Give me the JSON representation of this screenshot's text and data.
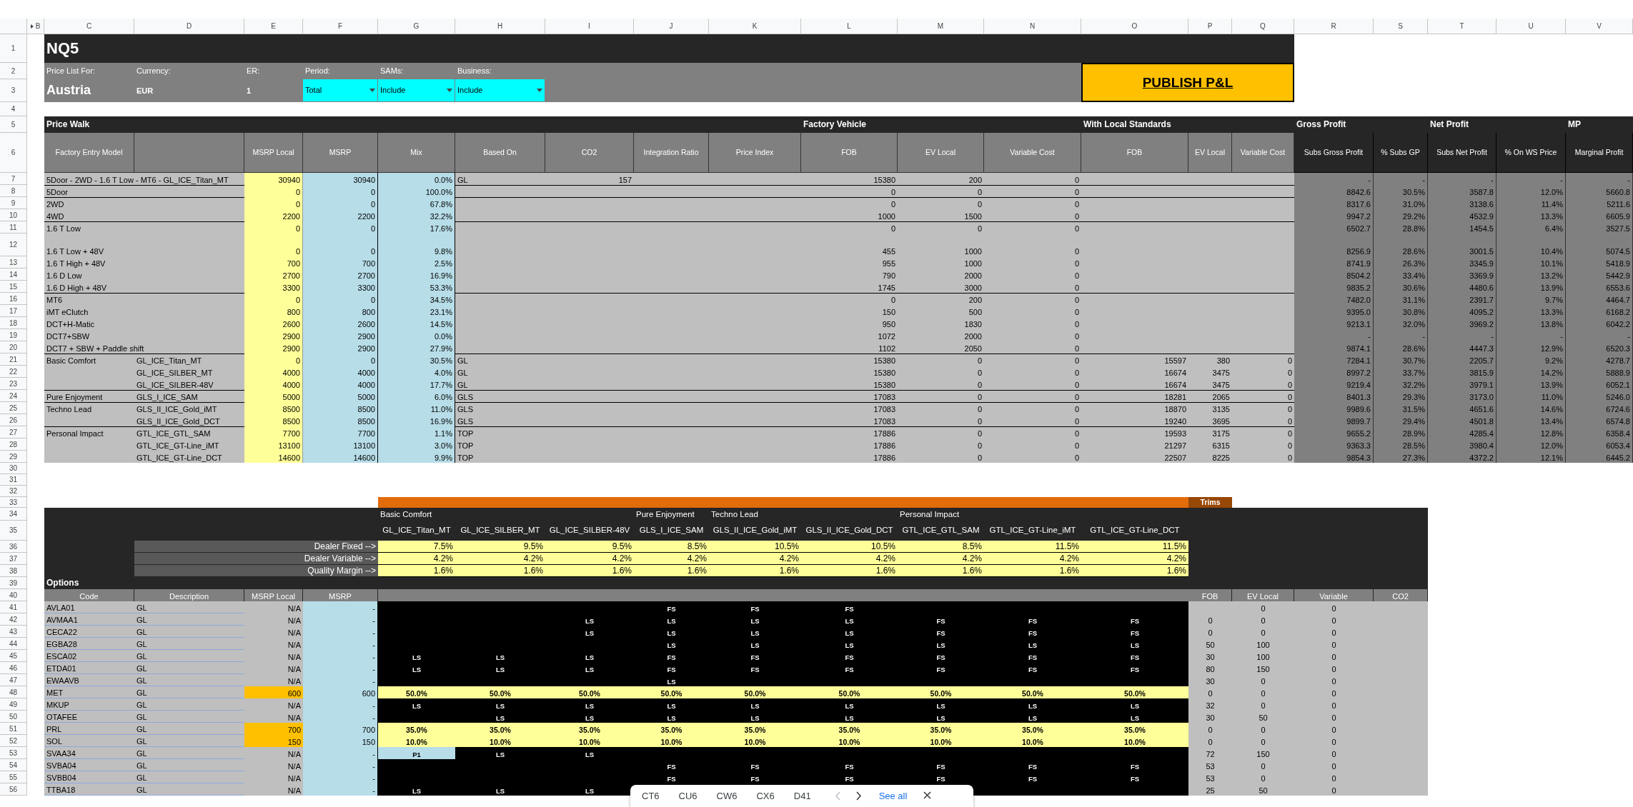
{
  "column_headers": [
    "B",
    "C",
    "D",
    "E",
    "F",
    "G",
    "H",
    "I",
    "J",
    "K",
    "L",
    "M",
    "N",
    "O",
    "P",
    "Q",
    "R",
    "S",
    "T",
    "U",
    "V"
  ],
  "row_numbers": [
    "1",
    "2",
    "3",
    "4",
    "5",
    "6",
    "7",
    "8",
    "9",
    "10",
    "11",
    "12",
    "13",
    "14",
    "15",
    "16",
    "17",
    "18",
    "19",
    "20",
    "21",
    "22",
    "23",
    "24",
    "25",
    "26",
    "27",
    "28",
    "29",
    "30",
    "31",
    "32",
    "33",
    "34",
    "35",
    "36",
    "37",
    "38",
    "39",
    "40",
    "41",
    "42",
    "43",
    "44",
    "45",
    "46",
    "47",
    "48",
    "49",
    "50",
    "51",
    "52",
    "53",
    "54",
    "55",
    "56"
  ],
  "header": {
    "title": "NQ5",
    "fields": [
      {
        "label": "Price List For:",
        "value": "Austria",
        "kind": "country"
      },
      {
        "label": "Currency:",
        "value": "EUR",
        "kind": "text"
      },
      {
        "label": "ER:",
        "value": "1",
        "kind": "number"
      },
      {
        "label": "Period:",
        "value": "Total",
        "kind": "dropdown"
      },
      {
        "label": "SAMs:",
        "value": "Include",
        "kind": "dropdown"
      },
      {
        "label": "Business:",
        "value": "Include",
        "kind": "dropdown"
      }
    ],
    "publish_button": "PUBLISH P&L"
  },
  "price_walk": {
    "title": "Price Walk",
    "bands": [
      "Factory Vehicle",
      "With Local Standards",
      "Gross Profit",
      "Net Profit",
      "MP"
    ],
    "columns": [
      "Factory Entry Model",
      "MSRP Local",
      "MSRP",
      "Mix",
      "Based On",
      "CO2",
      "Integration Ratio",
      "Price Index",
      "FOB",
      "EV Local",
      "Variable Cost",
      "FOB",
      "EV Local",
      "Variable Cost",
      "Subs Gross Profit",
      "% Subs GP",
      "Subs Net Profit",
      "% On WS Price",
      "Marginal Profit"
    ],
    "groups": [
      {
        "rows": [
          {
            "label": "5Door - 2WD - 1.6 T Low - MT6 - GL_ICE_Titan_MT",
            "msrp_local": "30940",
            "msrp": "30940",
            "mix": "0.0%",
            "based_on": "GL",
            "co2": "157",
            "fob": "15380",
            "ev_local": "200",
            "variable_cost": "0",
            "gross_profit": "-",
            "gp_pct": "-",
            "net_profit": "-",
            "ws_pct": "-",
            "marginal_profit": "-"
          }
        ]
      },
      {
        "rows": [
          {
            "label": "5Door",
            "msrp_local": "0",
            "msrp": "0",
            "mix": "100.0%",
            "fob": "0",
            "ev_local": "0",
            "variable_cost": "0",
            "gross_profit": "8842.6",
            "gp_pct": "30.5%",
            "net_profit": "3587.8",
            "ws_pct": "12.0%",
            "marginal_profit": "5660.8"
          }
        ]
      },
      {
        "rows": [
          {
            "label": "2WD",
            "msrp_local": "0",
            "msrp": "0",
            "mix": "67.8%",
            "fob": "0",
            "ev_local": "0",
            "variable_cost": "0",
            "gross_profit": "8317.6",
            "gp_pct": "31.0%",
            "net_profit": "3138.6",
            "ws_pct": "11.4%",
            "marginal_profit": "5211.6"
          },
          {
            "label": "4WD",
            "msrp_local": "2200",
            "msrp": "2200",
            "mix": "32.2%",
            "fob": "1000",
            "ev_local": "1500",
            "variable_cost": "0",
            "gross_profit": "9947.2",
            "gp_pct": "29.2%",
            "net_profit": "4532.9",
            "ws_pct": "13.3%",
            "marginal_profit": "6605.9"
          }
        ]
      },
      {
        "rows": [
          {
            "label": "1.6 T Low",
            "msrp_local": "0",
            "msrp": "0",
            "mix": "17.6%",
            "fob": "0",
            "ev_local": "0",
            "variable_cost": "0",
            "gross_profit": "6502.7",
            "gp_pct": "28.8%",
            "net_profit": "1454.5",
            "ws_pct": "6.4%",
            "marginal_profit": "3527.5"
          },
          {
            "label": "1.6 T Low + 48V",
            "msrp_local": "0",
            "msrp": "0",
            "mix": "9.8%",
            "fob": "455",
            "ev_local": "1000",
            "variable_cost": "0",
            "gross_profit": "8256.9",
            "gp_pct": "28.6%",
            "net_profit": "3001.5",
            "ws_pct": "10.4%",
            "marginal_profit": "5074.5"
          },
          {
            "label": "1.6 T High + 48V",
            "msrp_local": "700",
            "msrp": "700",
            "mix": "2.5%",
            "fob": "955",
            "ev_local": "1000",
            "variable_cost": "0",
            "gross_profit": "8741.9",
            "gp_pct": "26.3%",
            "net_profit": "3345.9",
            "ws_pct": "10.1%",
            "marginal_profit": "5418.9"
          },
          {
            "label": "1.6 D Low",
            "msrp_local": "2700",
            "msrp": "2700",
            "mix": "16.9%",
            "fob": "790",
            "ev_local": "2000",
            "variable_cost": "0",
            "gross_profit": "8504.2",
            "gp_pct": "33.4%",
            "net_profit": "3369.9",
            "ws_pct": "13.2%",
            "marginal_profit": "5442.9"
          },
          {
            "label": "1.6 D High + 48V",
            "msrp_local": "3300",
            "msrp": "3300",
            "mix": "53.3%",
            "fob": "1745",
            "ev_local": "3000",
            "variable_cost": "0",
            "gross_profit": "9835.2",
            "gp_pct": "30.6%",
            "net_profit": "4480.6",
            "ws_pct": "13.9%",
            "marginal_profit": "6553.6"
          }
        ]
      },
      {
        "rows": [
          {
            "label": "MT6",
            "msrp_local": "0",
            "msrp": "0",
            "mix": "34.5%",
            "fob": "0",
            "ev_local": "200",
            "variable_cost": "0",
            "gross_profit": "7482.0",
            "gp_pct": "31.1%",
            "net_profit": "2391.7",
            "ws_pct": "9.7%",
            "marginal_profit": "4464.7"
          },
          {
            "label": "iMT eClutch",
            "msrp_local": "800",
            "msrp": "800",
            "mix": "23.1%",
            "fob": "150",
            "ev_local": "500",
            "variable_cost": "0",
            "gross_profit": "9395.0",
            "gp_pct": "30.8%",
            "net_profit": "4095.2",
            "ws_pct": "13.3%",
            "marginal_profit": "6168.2"
          },
          {
            "label": "DCT+H-Matic",
            "msrp_local": "2600",
            "msrp": "2600",
            "mix": "14.5%",
            "fob": "950",
            "ev_local": "1830",
            "variable_cost": "0",
            "gross_profit": "9213.1",
            "gp_pct": "32.0%",
            "net_profit": "3969.2",
            "ws_pct": "13.8%",
            "marginal_profit": "6042.2"
          },
          {
            "label": "DCT7+SBW",
            "msrp_local": "2900",
            "msrp": "2900",
            "mix": "0.0%",
            "fob": "1072",
            "ev_local": "2000",
            "variable_cost": "0",
            "gross_profit": "-",
            "gp_pct": "-",
            "net_profit": "-",
            "ws_pct": "-",
            "marginal_profit": "-"
          },
          {
            "label": "DCT7 + SBW + Paddle shift",
            "msrp_local": "2900",
            "msrp": "2900",
            "mix": "27.9%",
            "fob": "1102",
            "ev_local": "2050",
            "variable_cost": "0",
            "gross_profit": "9874.1",
            "gp_pct": "28.6%",
            "net_profit": "4447.3",
            "ws_pct": "12.9%",
            "marginal_profit": "6520.3"
          }
        ]
      },
      {
        "rows": [
          {
            "label": "Basic Comfort",
            "model": "GL_ICE_Titan_MT",
            "msrp_local": "0",
            "msrp": "0",
            "mix": "30.5%",
            "based_on": "GL",
            "fob": "15380",
            "ev_local": "0",
            "variable_cost": "0",
            "ls_fob": "15597",
            "ls_ev_local": "380",
            "ls_variable_cost": "0",
            "gross_profit": "7284.1",
            "gp_pct": "30.7%",
            "net_profit": "2205.7",
            "ws_pct": "9.2%",
            "marginal_profit": "4278.7"
          },
          {
            "model": "GL_ICE_SILBER_MT",
            "msrp_local": "4000",
            "msrp": "4000",
            "mix": "4.0%",
            "based_on": "GL",
            "fob": "15380",
            "ev_local": "0",
            "variable_cost": "0",
            "ls_fob": "16674",
            "ls_ev_local": "3475",
            "ls_variable_cost": "0",
            "gross_profit": "8997.2",
            "gp_pct": "33.7%",
            "net_profit": "3815.9",
            "ws_pct": "14.2%",
            "marginal_profit": "5888.9"
          },
          {
            "model": "GL_ICE_SILBER-48V",
            "msrp_local": "4000",
            "msrp": "4000",
            "mix": "17.7%",
            "based_on": "GL",
            "fob": "15380",
            "ev_local": "0",
            "variable_cost": "0",
            "ls_fob": "16674",
            "ls_ev_local": "3475",
            "ls_variable_cost": "0",
            "gross_profit": "9219.4",
            "gp_pct": "32.2%",
            "net_profit": "3979.1",
            "ws_pct": "13.9%",
            "marginal_profit": "6052.1"
          }
        ]
      },
      {
        "rows": [
          {
            "label": "Pure Enjoyment",
            "model": "GLS_I_ICE_SAM",
            "msrp_local": "5000",
            "msrp": "5000",
            "mix": "6.0%",
            "based_on": "GLS",
            "fob": "17083",
            "ev_local": "0",
            "variable_cost": "0",
            "ls_fob": "18281",
            "ls_ev_local": "2065",
            "ls_variable_cost": "0",
            "gross_profit": "8401.3",
            "gp_pct": "29.3%",
            "net_profit": "3173.0",
            "ws_pct": "11.0%",
            "marginal_profit": "5246.0"
          }
        ]
      },
      {
        "rows": [
          {
            "label": "Techno Lead",
            "model": "GLS_II_ICE_Gold_iMT",
            "msrp_local": "8500",
            "msrp": "8500",
            "mix": "11.0%",
            "based_on": "GLS",
            "fob": "17083",
            "ev_local": "0",
            "variable_cost": "0",
            "ls_fob": "18870",
            "ls_ev_local": "3135",
            "ls_variable_cost": "0",
            "gross_profit": "9989.6",
            "gp_pct": "31.5%",
            "net_profit": "4651.6",
            "ws_pct": "14.6%",
            "marginal_profit": "6724.6"
          },
          {
            "model": "GLS_II_ICE_Gold_DCT",
            "msrp_local": "8500",
            "msrp": "8500",
            "mix": "16.9%",
            "based_on": "GLS",
            "fob": "17083",
            "ev_local": "0",
            "variable_cost": "0",
            "ls_fob": "19240",
            "ls_ev_local": "3695",
            "ls_variable_cost": "0",
            "gross_profit": "9899.7",
            "gp_pct": "29.4%",
            "net_profit": "4501.8",
            "ws_pct": "13.4%",
            "marginal_profit": "6574.8"
          }
        ]
      },
      {
        "rows": [
          {
            "label": "Personal Impact",
            "model": "GTL_ICE_GTL_SAM",
            "msrp_local": "7700",
            "msrp": "7700",
            "mix": "1.1%",
            "based_on": "TOP",
            "fob": "17886",
            "ev_local": "0",
            "variable_cost": "0",
            "ls_fob": "19593",
            "ls_ev_local": "3175",
            "ls_variable_cost": "0",
            "gross_profit": "9655.2",
            "gp_pct": "28.9%",
            "net_profit": "4285.4",
            "ws_pct": "12.8%",
            "marginal_profit": "6358.4"
          },
          {
            "model": "GTL_ICE_GT-Line_iMT",
            "msrp_local": "13100",
            "msrp": "13100",
            "mix": "3.0%",
            "based_on": "TOP",
            "fob": "17886",
            "ev_local": "0",
            "variable_cost": "0",
            "ls_fob": "21297",
            "ls_ev_local": "6315",
            "ls_variable_cost": "0",
            "gross_profit": "9363.3",
            "gp_pct": "28.5%",
            "net_profit": "3980.4",
            "ws_pct": "12.0%",
            "marginal_profit": "6053.4"
          },
          {
            "model": "GTL_ICE_GT-Line_DCT",
            "msrp_local": "14600",
            "msrp": "14600",
            "mix": "9.9%",
            "based_on": "TOP",
            "fob": "17886",
            "ev_local": "0",
            "variable_cost": "0",
            "ls_fob": "22507",
            "ls_ev_local": "8225",
            "ls_variable_cost": "0",
            "gross_profit": "9854.3",
            "gp_pct": "27.3%",
            "net_profit": "4372.2",
            "ws_pct": "12.1%",
            "marginal_profit": "6445.2"
          }
        ]
      }
    ]
  },
  "trims": {
    "header": "Trims",
    "groups": [
      {
        "name": "Basic Comfort",
        "models": [
          "GL_ICE_Titan_MT",
          "GL_ICE_SILBER_MT",
          "GL_ICE_SILBER-48V"
        ]
      },
      {
        "name": "Pure Enjoyment",
        "models": [
          "GLS_I_ICE_SAM"
        ]
      },
      {
        "name": "Techno Lead",
        "models": [
          "GLS_II_ICE_Gold_iMT",
          "GLS_II_ICE_Gold_DCT"
        ]
      },
      {
        "name": "Personal Impact",
        "models": [
          "GTL_ICE_GTL_SAM",
          "GTL_ICE_GT-Line_iMT",
          "GTL_ICE_GT-Line_DCT"
        ]
      }
    ],
    "margins": [
      {
        "label": "Dealer Fixed -->",
        "values": [
          "7.5%",
          "9.5%",
          "9.5%",
          "8.5%",
          "10.5%",
          "10.5%",
          "8.5%",
          "11.5%",
          "11.5%"
        ]
      },
      {
        "label": "Dealer Variable -->",
        "values": [
          "4.2%",
          "4.2%",
          "4.2%",
          "4.2%",
          "4.2%",
          "4.2%",
          "4.2%",
          "4.2%",
          "4.2%"
        ]
      },
      {
        "label": "Quality Margin -->",
        "values": [
          "1.6%",
          "1.6%",
          "1.6%",
          "1.6%",
          "1.6%",
          "1.6%",
          "1.6%",
          "1.6%",
          "1.6%"
        ]
      }
    ]
  },
  "options": {
    "title": "Options",
    "columns": [
      "Code",
      "Description",
      "MSRP Local",
      "MSRP"
    ],
    "cost_columns": [
      "FOB",
      "EV Local",
      "Variable",
      "CO2"
    ],
    "rows": [
      {
        "kind": "standard",
        "code": "AVLA01",
        "description": "GL",
        "msrp_local": "N/A",
        "msrp": "-",
        "fitment": [
          {
            "kind": "blank"
          },
          {
            "kind": "blank"
          },
          {
            "kind": "blank"
          },
          {
            "kind": "standard",
            "value": "FS"
          },
          {
            "kind": "standard",
            "value": "FS"
          },
          {
            "kind": "standard",
            "value": "FS"
          },
          {
            "kind": "blank"
          },
          {
            "kind": "blank"
          },
          {
            "kind": "blank"
          }
        ],
        "ev_local": "0",
        "variable": "0"
      },
      {
        "kind": "standard",
        "code": "AVMAA1",
        "description": "GL",
        "msrp_local": "N/A",
        "msrp": "-",
        "fitment": [
          {
            "kind": "blank"
          },
          {
            "kind": "blank"
          },
          {
            "kind": "standard",
            "value": "LS"
          },
          {
            "kind": "standard",
            "value": "LS"
          },
          {
            "kind": "standard",
            "value": "LS"
          },
          {
            "kind": "standard",
            "value": "LS"
          },
          {
            "kind": "standard",
            "value": "FS"
          },
          {
            "kind": "standard",
            "value": "FS"
          },
          {
            "kind": "standard",
            "value": "FS"
          }
        ],
        "fob": "0",
        "ev_local": "0",
        "variable": "0"
      },
      {
        "kind": "standard",
        "code": "CECA22",
        "description": "GL",
        "msrp_local": "N/A",
        "msrp": "-",
        "fitment": [
          {
            "kind": "blank"
          },
          {
            "kind": "blank"
          },
          {
            "kind": "standard",
            "value": "LS"
          },
          {
            "kind": "standard",
            "value": "LS"
          },
          {
            "kind": "standard",
            "value": "LS"
          },
          {
            "kind": "standard",
            "value": "LS"
          },
          {
            "kind": "standard",
            "value": "FS"
          },
          {
            "kind": "standard",
            "value": "FS"
          },
          {
            "kind": "standard",
            "value": "FS"
          }
        ],
        "fob": "0",
        "ev_local": "0",
        "variable": "0"
      },
      {
        "kind": "standard",
        "code": "EGBA28",
        "description": "GL",
        "msrp_local": "N/A",
        "msrp": "-",
        "fitment": [
          {
            "kind": "blank"
          },
          {
            "kind": "blank"
          },
          {
            "kind": "blank"
          },
          {
            "kind": "standard",
            "value": "LS"
          },
          {
            "kind": "standard",
            "value": "LS"
          },
          {
            "kind": "standard",
            "value": "LS"
          },
          {
            "kind": "standard",
            "value": "LS"
          },
          {
            "kind": "standard",
            "value": "LS"
          },
          {
            "kind": "standard",
            "value": "LS"
          }
        ],
        "fob": "50",
        "ev_local": "100",
        "variable": "0"
      },
      {
        "kind": "standard",
        "code": "ESCA02",
        "description": "GL",
        "msrp_local": "N/A",
        "msrp": "-",
        "fitment": [
          {
            "kind": "standard",
            "value": "LS"
          },
          {
            "kind": "standard",
            "value": "LS"
          },
          {
            "kind": "standard",
            "value": "LS"
          },
          {
            "kind": "standard",
            "value": "FS"
          },
          {
            "kind": "standard",
            "value": "FS"
          },
          {
            "kind": "standard",
            "value": "FS"
          },
          {
            "kind": "standard",
            "value": "FS"
          },
          {
            "kind": "standard",
            "value": "FS"
          },
          {
            "kind": "standard",
            "value": "FS"
          }
        ],
        "fob": "30",
        "ev_local": "100",
        "variable": "0"
      },
      {
        "kind": "standard",
        "code": "ETDA01",
        "description": "GL",
        "msrp_local": "N/A",
        "msrp": "-",
        "fitment": [
          {
            "kind": "standard",
            "value": "LS"
          },
          {
            "kind": "standard",
            "value": "LS"
          },
          {
            "kind": "standard",
            "value": "LS"
          },
          {
            "kind": "standard",
            "value": "FS"
          },
          {
            "kind": "standard",
            "value": "FS"
          },
          {
            "kind": "standard",
            "value": "FS"
          },
          {
            "kind": "standard",
            "value": "FS"
          },
          {
            "kind": "standard",
            "value": "FS"
          },
          {
            "kind": "standard",
            "value": "FS"
          }
        ],
        "fob": "80",
        "ev_local": "150",
        "variable": "0"
      },
      {
        "kind": "standard",
        "code": "EWAAVB",
        "description": "GL",
        "msrp_local": "N/A",
        "msrp": "-",
        "fitment": [
          {
            "kind": "blank"
          },
          {
            "kind": "blank"
          },
          {
            "kind": "blank"
          },
          {
            "kind": "standard",
            "value": "LS"
          },
          {
            "kind": "blank"
          },
          {
            "kind": "blank"
          },
          {
            "kind": "blank"
          },
          {
            "kind": "blank"
          },
          {
            "kind": "blank"
          }
        ],
        "fob": "30",
        "ev_local": "0",
        "variable": "0"
      },
      {
        "kind": "priced",
        "code": "MET",
        "description": "GL",
        "msrp_local": "600",
        "msrp": "600",
        "fitment": [
          {
            "kind": "rate",
            "value": "50.0%"
          },
          {
            "kind": "rate",
            "value": "50.0%"
          },
          {
            "kind": "rate",
            "value": "50.0%"
          },
          {
            "kind": "rate",
            "value": "50.0%"
          },
          {
            "kind": "rate",
            "value": "50.0%"
          },
          {
            "kind": "rate",
            "value": "50.0%"
          },
          {
            "kind": "rate",
            "value": "50.0%"
          },
          {
            "kind": "rate",
            "value": "50.0%"
          },
          {
            "kind": "rate",
            "value": "50.0%"
          }
        ],
        "fob": "0",
        "ev_local": "0",
        "variable": "0"
      },
      {
        "kind": "standard",
        "code": "MKUP",
        "description": "GL",
        "msrp_local": "N/A",
        "msrp": "-",
        "fitment": [
          {
            "kind": "standard",
            "value": "LS"
          },
          {
            "kind": "standard",
            "value": "LS"
          },
          {
            "kind": "standard",
            "value": "LS"
          },
          {
            "kind": "standard",
            "value": "LS"
          },
          {
            "kind": "standard",
            "value": "LS"
          },
          {
            "kind": "standard",
            "value": "LS"
          },
          {
            "kind": "standard",
            "value": "LS"
          },
          {
            "kind": "standard",
            "value": "LS"
          },
          {
            "kind": "standard",
            "value": "LS"
          }
        ],
        "fob": "32",
        "ev_local": "0",
        "variable": "0"
      },
      {
        "kind": "standard",
        "code": "OTAFEE",
        "description": "GL",
        "msrp_local": "N/A",
        "msrp": "-",
        "fitment": [
          {
            "kind": "blank"
          },
          {
            "kind": "standard",
            "value": "LS"
          },
          {
            "kind": "standard",
            "value": "LS"
          },
          {
            "kind": "standard",
            "value": "LS"
          },
          {
            "kind": "standard",
            "value": "LS"
          },
          {
            "kind": "standard",
            "value": "LS"
          },
          {
            "kind": "standard",
            "value": "LS"
          },
          {
            "kind": "standard",
            "value": "LS"
          },
          {
            "kind": "standard",
            "value": "LS"
          }
        ],
        "fob": "30",
        "ev_local": "50",
        "variable": "0"
      },
      {
        "kind": "priced",
        "code": "PRL",
        "description": "GL",
        "msrp_local": "700",
        "msrp": "700",
        "fitment": [
          {
            "kind": "rate",
            "value": "35.0%"
          },
          {
            "kind": "rate",
            "value": "35.0%"
          },
          {
            "kind": "rate",
            "value": "35.0%"
          },
          {
            "kind": "rate",
            "value": "35.0%"
          },
          {
            "kind": "rate",
            "value": "35.0%"
          },
          {
            "kind": "rate",
            "value": "35.0%"
          },
          {
            "kind": "rate",
            "value": "35.0%"
          },
          {
            "kind": "rate",
            "value": "35.0%"
          },
          {
            "kind": "rate",
            "value": "35.0%"
          }
        ],
        "fob": "0",
        "ev_local": "0",
        "variable": "0"
      },
      {
        "kind": "priced",
        "code": "SOL",
        "description": "GL",
        "msrp_local": "150",
        "msrp": "150",
        "fitment": [
          {
            "kind": "rate",
            "value": "10.0%"
          },
          {
            "kind": "rate",
            "value": "10.0%"
          },
          {
            "kind": "rate",
            "value": "10.0%"
          },
          {
            "kind": "rate",
            "value": "10.0%"
          },
          {
            "kind": "rate",
            "value": "10.0%"
          },
          {
            "kind": "rate",
            "value": "10.0%"
          },
          {
            "kind": "rate",
            "value": "10.0%"
          },
          {
            "kind": "rate",
            "value": "10.0%"
          },
          {
            "kind": "rate",
            "value": "10.0%"
          }
        ],
        "fob": "0",
        "ev_local": "0",
        "variable": "0"
      },
      {
        "kind": "standard",
        "code": "SVAA34",
        "description": "GL",
        "msrp_local": "N/A",
        "msrp": "-",
        "fitment": [
          {
            "kind": "package",
            "value": "P1"
          },
          {
            "kind": "standard",
            "value": "LS"
          },
          {
            "kind": "standard",
            "value": "LS"
          },
          {
            "kind": "blank"
          },
          {
            "kind": "blank"
          },
          {
            "kind": "blank"
          },
          {
            "kind": "blank"
          },
          {
            "kind": "blank"
          },
          {
            "kind": "blank"
          }
        ],
        "fob": "72",
        "ev_local": "150",
        "variable": "0"
      },
      {
        "kind": "standard",
        "code": "SVBA04",
        "description": "GL",
        "msrp_local": "N/A",
        "msrp": "-",
        "fitment": [
          {
            "kind": "blank"
          },
          {
            "kind": "blank"
          },
          {
            "kind": "blank"
          },
          {
            "kind": "standard",
            "value": "FS"
          },
          {
            "kind": "standard",
            "value": "FS"
          },
          {
            "kind": "standard",
            "value": "FS"
          },
          {
            "kind": "standard",
            "value": "FS"
          },
          {
            "kind": "standard",
            "value": "FS"
          },
          {
            "kind": "standard",
            "value": "FS"
          }
        ],
        "fob": "53",
        "ev_local": "0",
        "variable": "0"
      },
      {
        "kind": "standard",
        "code": "SVBB04",
        "description": "GL",
        "msrp_local": "N/A",
        "msrp": "-",
        "fitment": [
          {
            "kind": "blank"
          },
          {
            "kind": "blank"
          },
          {
            "kind": "blank"
          },
          {
            "kind": "standard",
            "value": "FS"
          },
          {
            "kind": "standard",
            "value": "FS"
          },
          {
            "kind": "standard",
            "value": "FS"
          },
          {
            "kind": "standard",
            "value": "FS"
          },
          {
            "kind": "standard",
            "value": "FS"
          },
          {
            "kind": "standard",
            "value": "FS"
          }
        ],
        "fob": "53",
        "ev_local": "0",
        "variable": "0"
      },
      {
        "kind": "standard",
        "code": "TTBA18",
        "description": "GL",
        "msrp_local": "N/A",
        "msrp": "-",
        "fitment": [
          {
            "kind": "standard",
            "value": "LS"
          },
          {
            "kind": "standard",
            "value": "LS"
          },
          {
            "kind": "standard",
            "value": "LS"
          },
          {
            "kind": "blank"
          },
          {
            "kind": "blank"
          },
          {
            "kind": "blank"
          },
          {
            "kind": "blank"
          },
          {
            "kind": "blank"
          },
          {
            "kind": "blank"
          }
        ],
        "fob": "25",
        "ev_local": "50",
        "variable": "0"
      }
    ]
  },
  "toast": {
    "chips": [
      "CT6",
      "CU6",
      "CW6",
      "CX6",
      "D41"
    ],
    "previous": {
      "disabled": true
    },
    "next": {
      "disabled": false
    },
    "link": "See all"
  }
}
